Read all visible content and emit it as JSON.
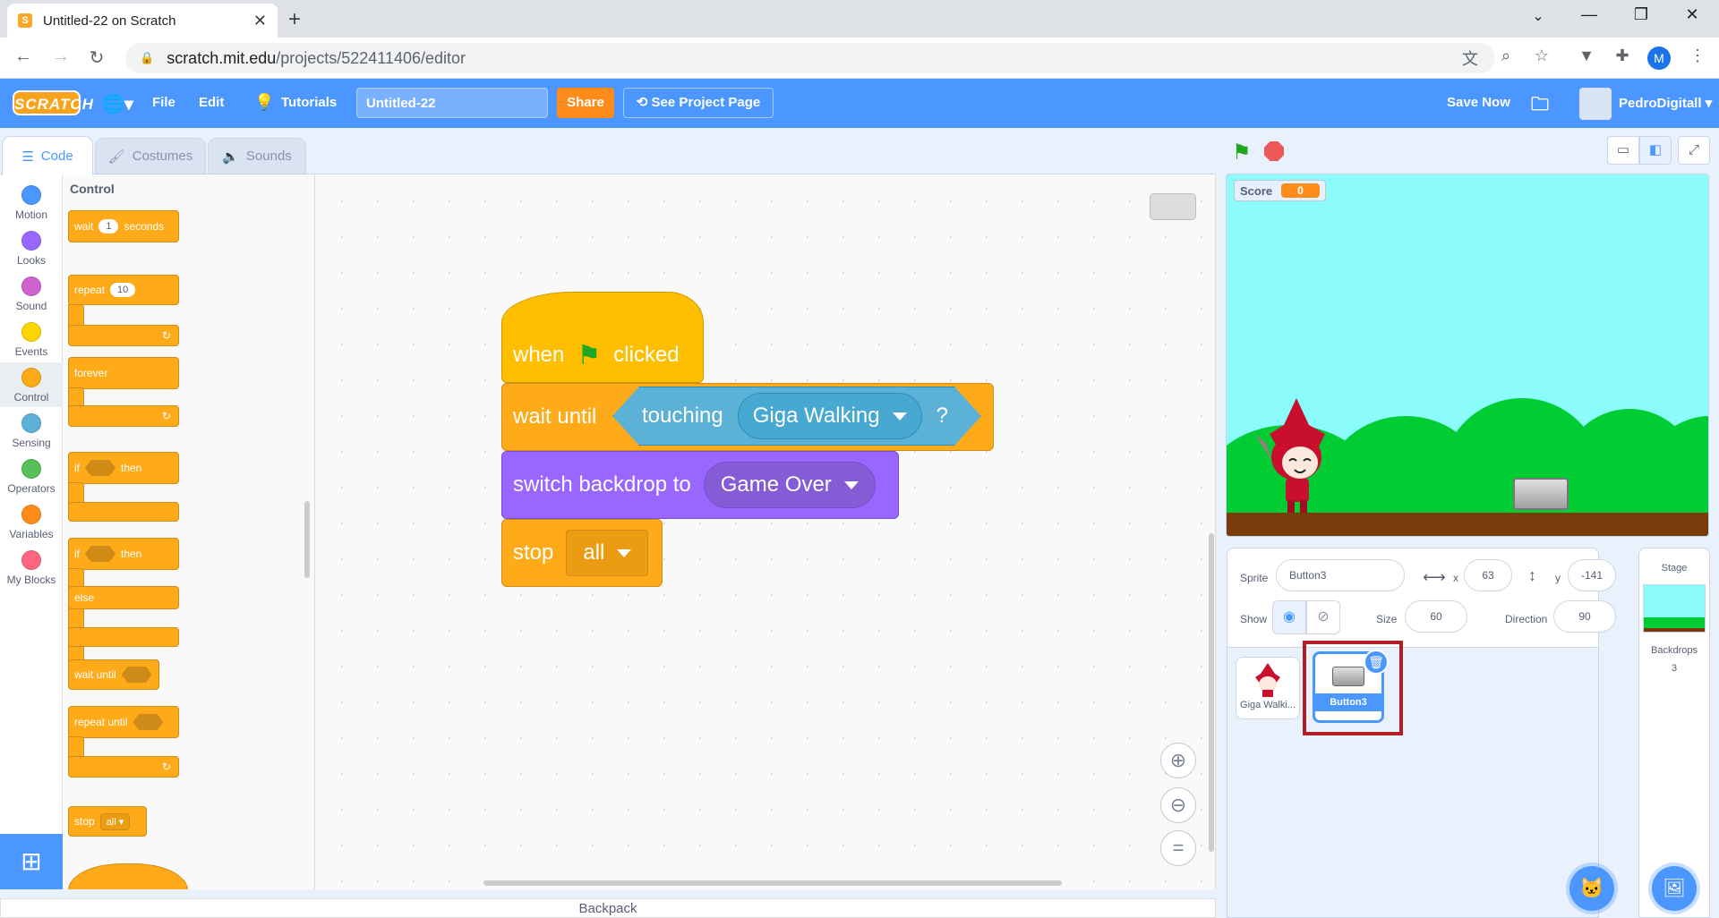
{
  "browser": {
    "tab_title": "Untitled-22 on Scratch",
    "url_host": "scratch.mit.edu",
    "url_path": "/projects/522411406/editor",
    "profile_initial": "M"
  },
  "menubar": {
    "logo": "SCRATCH",
    "file": "File",
    "edit": "Edit",
    "tutorials": "Tutorials",
    "project_title": "Untitled-22",
    "share": "Share",
    "see_project": "See Project Page",
    "save_now": "Save Now",
    "username": "PedroDigitall"
  },
  "tabs": {
    "code": "Code",
    "costumes": "Costumes",
    "sounds": "Sounds"
  },
  "categories": [
    {
      "label": "Motion",
      "color": "#4c97ff"
    },
    {
      "label": "Looks",
      "color": "#9966ff"
    },
    {
      "label": "Sound",
      "color": "#cf63cf"
    },
    {
      "label": "Events",
      "color": "#ffd500"
    },
    {
      "label": "Control",
      "color": "#ffab19"
    },
    {
      "label": "Sensing",
      "color": "#5cb1d6"
    },
    {
      "label": "Operators",
      "color": "#59c059"
    },
    {
      "label": "Variables",
      "color": "#ff8c1a"
    },
    {
      "label": "My Blocks",
      "color": "#ff6680"
    }
  ],
  "palette": {
    "title": "Control",
    "wait": "wait",
    "wait_num": "1",
    "seconds": "seconds",
    "repeat": "repeat",
    "repeat_num": "10",
    "forever": "forever",
    "if": "if",
    "then": "then",
    "else": "else",
    "wait_until": "wait until",
    "repeat_until": "repeat until",
    "stop": "stop",
    "stop_opt": "all"
  },
  "script": {
    "when": "when",
    "clicked": "clicked",
    "wait_until": "wait until",
    "touching": "touching",
    "touching_target": "Giga Walking",
    "q": "?",
    "switch_backdrop": "switch backdrop to",
    "backdrop": "Game Over",
    "stop": "stop",
    "stop_opt": "all"
  },
  "backpack": "Backpack",
  "stage": {
    "score_label": "Score",
    "score_value": "0"
  },
  "sprite_info": {
    "sprite_label": "Sprite",
    "sprite_name": "Button3",
    "x_label": "x",
    "x": "63",
    "y_label": "y",
    "y": "-141",
    "show_label": "Show",
    "size_label": "Size",
    "size": "60",
    "direction_label": "Direction",
    "direction": "90"
  },
  "sprites": [
    {
      "name": "Giga Walki..."
    },
    {
      "name": "Button3"
    }
  ],
  "stage_pane": {
    "title": "Stage",
    "backdrops_label": "Backdrops",
    "backdrops_count": "3"
  },
  "colors": {
    "scratch_blue": "#4c97ff",
    "control": "#ffab19",
    "events": "#ffbf00",
    "looks": "#9966ff",
    "sensing": "#5cb1d6",
    "highlight": "#b11f24"
  }
}
